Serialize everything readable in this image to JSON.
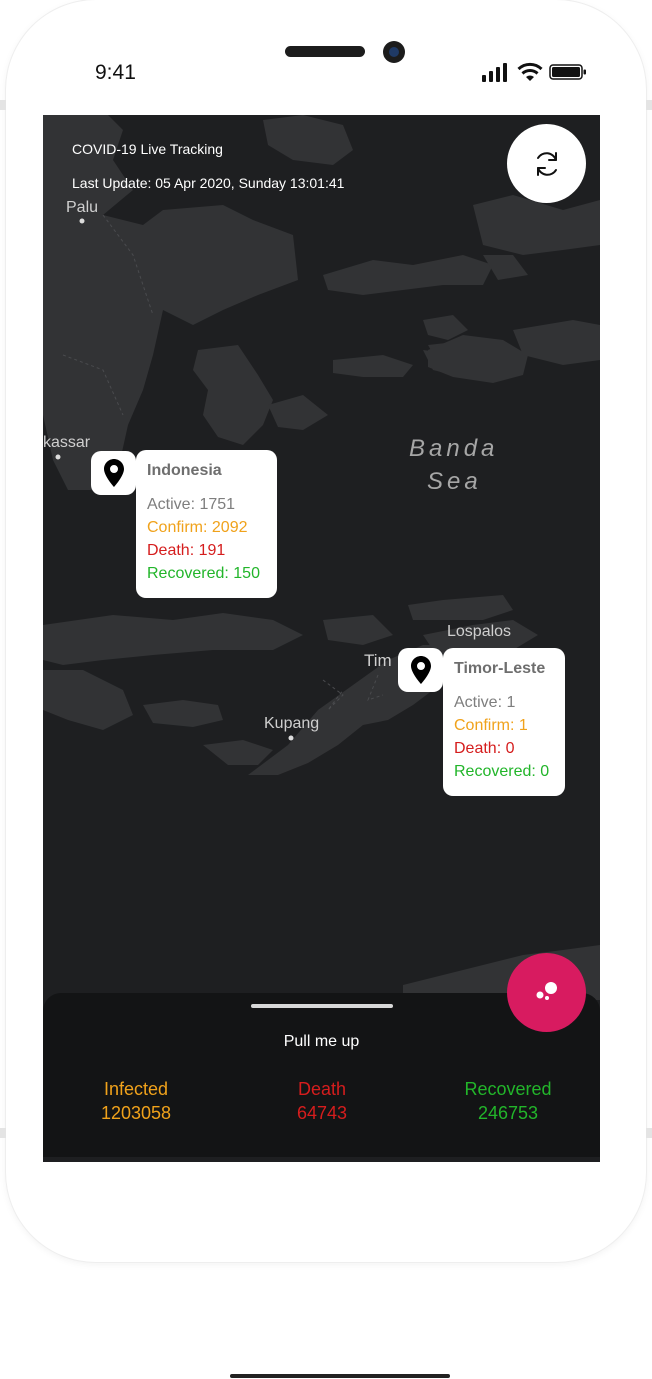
{
  "status_bar": {
    "time": "9:41"
  },
  "app": {
    "title": "COVID-19 Live Tracking",
    "last_update": "Last Update: 05 Apr 2020, Sunday 13:01:41"
  },
  "map_labels": {
    "palu": "Palu",
    "makassar": "kassar",
    "banda_sea_line1": "Banda",
    "banda_sea_line2": "Sea",
    "lospalos": "Lospalos",
    "timor": "Tim",
    "kupang": "Kupang"
  },
  "markers": [
    {
      "country": "Indonesia",
      "active": "Active: 1751",
      "confirm": "Confirm: 2092",
      "death": "Death: 191",
      "recovered": "Recovered: 150"
    },
    {
      "country": "Timor-Leste",
      "active": "Active: 1",
      "confirm": "Confirm: 1",
      "death": "Death: 0",
      "recovered": "Recovered: 0"
    }
  ],
  "bottom_sheet": {
    "pull_label": "Pull me up",
    "infected_label": "Infected",
    "infected_value": "1203058",
    "death_label": "Death",
    "death_value": "64743",
    "recovered_label": "Recovered",
    "recovered_value": "246753"
  },
  "colors": {
    "confirm": "#f0a21b",
    "death": "#d51d1d",
    "recovered": "#22b52a",
    "fab": "#d81b60",
    "map_background": "#1e1f21"
  },
  "icons": {
    "refresh": "refresh-icon",
    "marker": "map-pin-icon",
    "fab": "bubbles-icon"
  }
}
